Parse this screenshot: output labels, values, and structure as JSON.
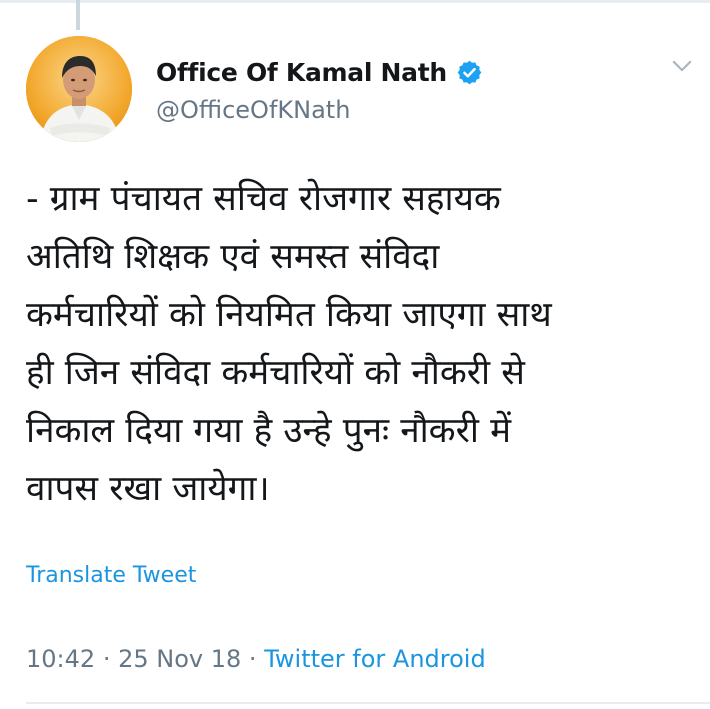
{
  "tweet": {
    "display_name": "Office Of Kamal Nath",
    "handle": "@OfficeOfKNath",
    "verified_icon": "verified-badge-icon",
    "menu_icon": "chevron-down-icon",
    "text_lines": [
      "- ग्राम पंचायत सचिव रोजगार सहायक",
      "अतिथि शिक्षक एवं समस्त संविदा",
      "कर्मचारियों को नियमित किया जाएगा साथ",
      "ही जिन संविदा कर्मचारियों को नौकरी से",
      "निकाल दिया गया है उन्हे पुनः नौकरी में",
      "वापस रखा जायेगा।"
    ],
    "translate_label": "Translate Tweet",
    "time": "10:42",
    "separator": "·",
    "date": "25 Nov 18",
    "source": "Twitter for Android"
  },
  "colors": {
    "link": "#1b95e0",
    "secondary_text": "#657786",
    "primary_text": "#14171a",
    "verified": "#1da1f2"
  }
}
